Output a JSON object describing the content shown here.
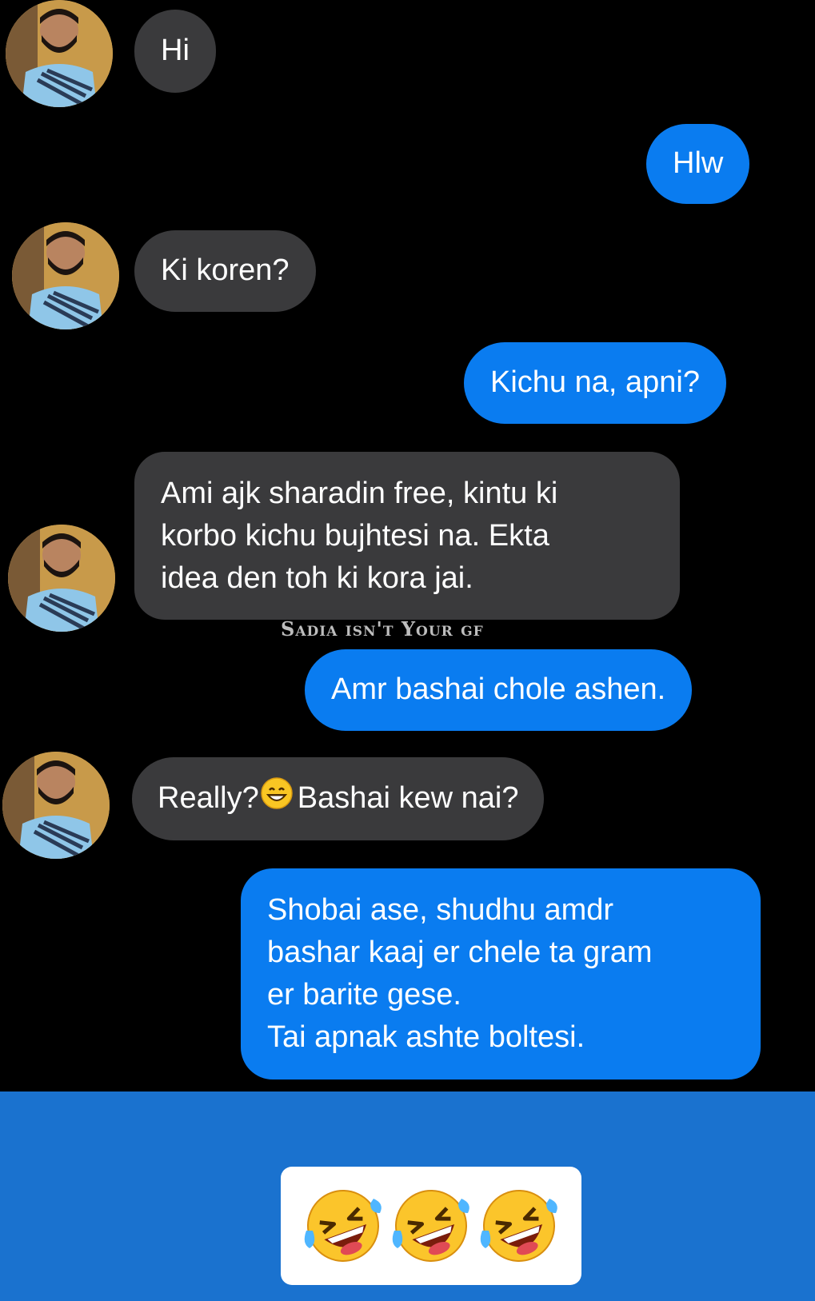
{
  "messages": [
    {
      "side": "incoming",
      "text": "Hi"
    },
    {
      "side": "outgoing",
      "text": "Hlw"
    },
    {
      "side": "incoming",
      "text": "Ki koren?"
    },
    {
      "side": "outgoing",
      "text": "Kichu na, apni?"
    },
    {
      "side": "incoming",
      "text": "Ami ajk sharadin free, kintu ki\nkorbo kichu bujhtesi na. Ekta\nidea den toh ki kora jai."
    },
    {
      "side": "outgoing",
      "text": "Amr bashai chole ashen."
    },
    {
      "side": "incoming",
      "text_before_emoji": "Really?",
      "emoji": "grinning-face-emoji",
      "text_after_emoji": "Bashai kew nai?"
    },
    {
      "side": "outgoing",
      "text": "Shobai ase, shudhu amdr\nbashar kaaj er chele ta gram\ner barite gese.\nTai apnak ashte boltesi."
    }
  ],
  "watermark": "Sadia isn't Your gf",
  "reaction": {
    "emoji": "rolling-on-the-floor-laughing-emoji",
    "count": 3
  },
  "colors": {
    "background": "#000000",
    "incoming_bubble": "#3a3a3c",
    "outgoing_bubble": "#0a7cf0",
    "footer": "#1a72cf",
    "text": "#ffffff"
  }
}
